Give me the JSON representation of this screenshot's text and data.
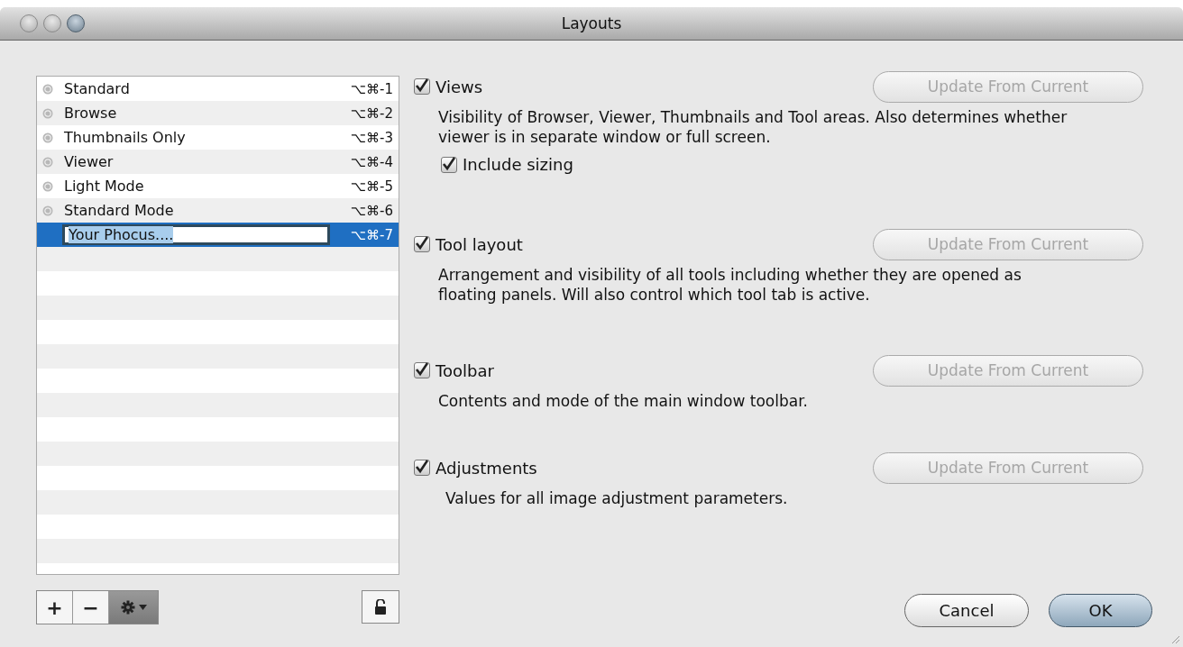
{
  "window": {
    "title": "Layouts"
  },
  "layouts": [
    {
      "kind": "preset",
      "label": "Standard",
      "shortcut": "⌥⌘-1",
      "selected": false
    },
    {
      "kind": "preset",
      "label": "Browse",
      "shortcut": "⌥⌘-2",
      "selected": false
    },
    {
      "kind": "preset",
      "label": "Thumbnails Only",
      "shortcut": "⌥⌘-3",
      "selected": false
    },
    {
      "kind": "preset",
      "label": "Viewer",
      "shortcut": "⌥⌘-4",
      "selected": false
    },
    {
      "kind": "preset",
      "label": "Light Mode",
      "shortcut": "⌥⌘-5",
      "selected": false
    },
    {
      "kind": "preset",
      "label": "Standard Mode",
      "shortcut": "⌥⌘-6",
      "selected": false
    },
    {
      "kind": "editing",
      "label": "Your Phocus....",
      "shortcut": "⌥⌘-7",
      "selected": true
    }
  ],
  "sections": [
    {
      "title": "Views",
      "checked": true,
      "button": {
        "label": "Update From Current",
        "disabled": true
      },
      "description": "Visibility of Browser, Viewer, Thumbnails and Tool areas. Also determines whether viewer is in separate window or full screen.",
      "option": {
        "label": "Include sizing",
        "checked": true
      }
    },
    {
      "title": "Tool layout",
      "checked": true,
      "button": {
        "label": "Update From Current",
        "disabled": true
      },
      "description": "Arrangement and visibility of all tools including whether they are opened as floating panels. Will also control which tool tab is active."
    },
    {
      "title": "Toolbar",
      "checked": true,
      "button": {
        "label": "Update From Current",
        "disabled": true
      },
      "description": "Contents and mode of the main window toolbar."
    },
    {
      "title": "Adjustments",
      "checked": true,
      "button": {
        "label": "Update From Current",
        "disabled": true
      },
      "description": "Values for all image adjustment parameters."
    }
  ],
  "list_tools": {
    "add": "+",
    "remove": "−",
    "locked": false
  },
  "buttons": [
    {
      "label": "Cancel",
      "default": false
    },
    {
      "label": "OK",
      "default": true
    }
  ]
}
